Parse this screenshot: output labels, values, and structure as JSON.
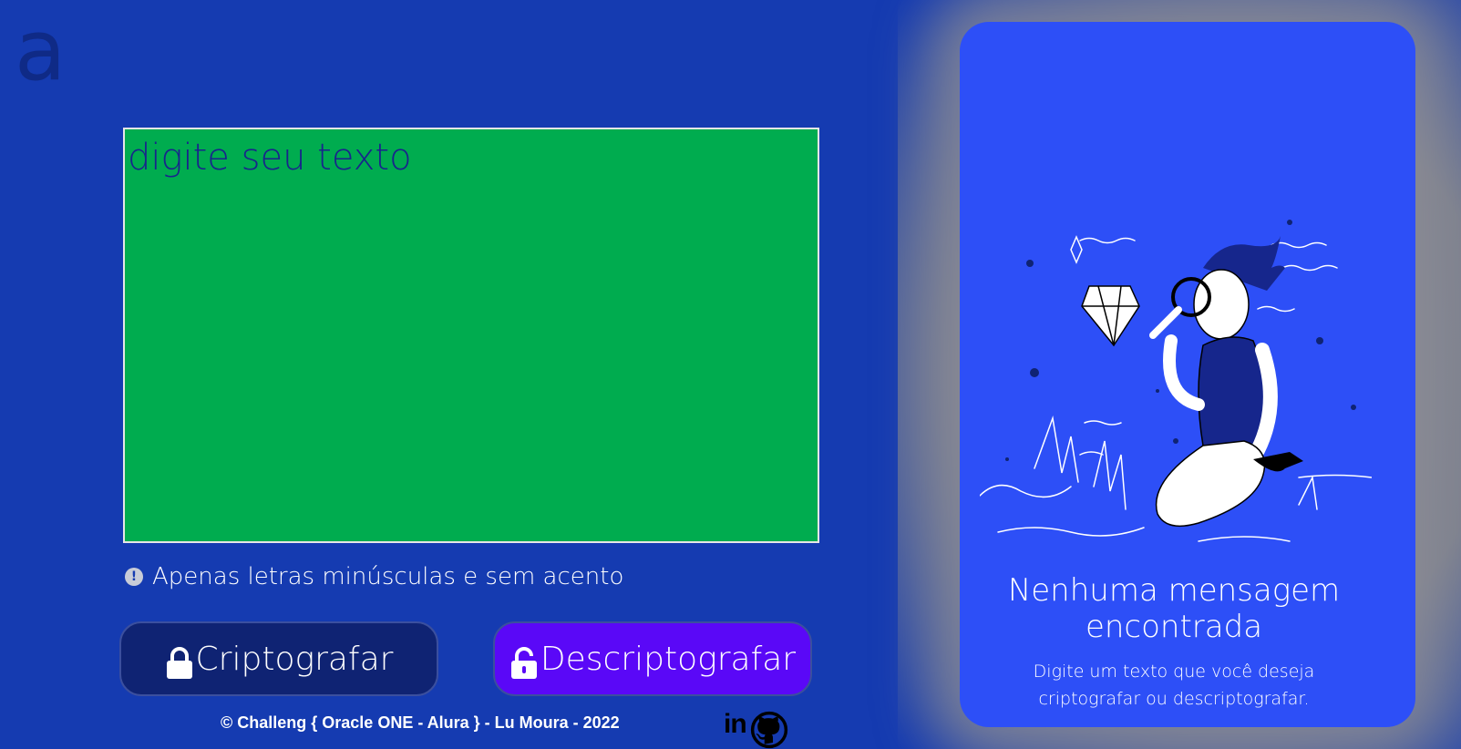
{
  "logo": {
    "text": "a"
  },
  "input": {
    "placeholder": "digite seu texto"
  },
  "hint": {
    "icon": "exclamation-circle-icon",
    "text": "Apenas letras minúsculas e sem acento"
  },
  "buttons": {
    "encrypt": {
      "label": "Criptografar",
      "icon": "lock-icon"
    },
    "decrypt": {
      "label": "Descriptografar",
      "icon": "unlock-icon"
    }
  },
  "footer": {
    "text": "© Challeng { Oracle ONE - Alura } - Lu Moura - 2022"
  },
  "social": {
    "linkedin_icon": "linkedin-icon",
    "github_icon": "github-icon",
    "linkedin_text": "in"
  },
  "panel": {
    "title": "Nenhuma mensagem encontrada",
    "subtitle": "Digite um texto que você deseja criptografar ou descriptografar."
  },
  "colors": {
    "background": "#153bb1",
    "textarea": "#00ac4f",
    "encrypt_button": "#0f2373",
    "decrypt_button": "#5a08f7",
    "panel": "#2d4ff7"
  }
}
